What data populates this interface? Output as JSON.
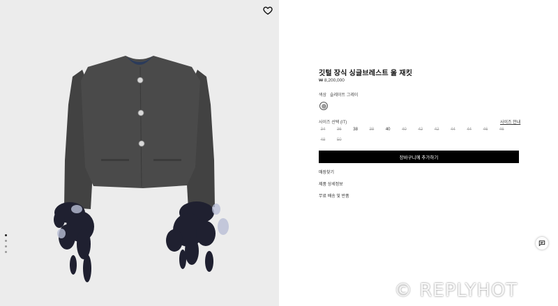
{
  "product": {
    "title": "깃털 장식 싱글브레스트 울 재킷",
    "price": "₩ 8,200,000"
  },
  "color": {
    "label": "색상",
    "value": "슬레이트 그레이"
  },
  "size": {
    "label": "사이즈 선택 (IT)",
    "guide": "사이즈 안내",
    "options": [
      {
        "label": "34",
        "available": false
      },
      {
        "label": "36",
        "available": false
      },
      {
        "label": "38",
        "available": true
      },
      {
        "label": "38",
        "available": false
      },
      {
        "label": "40",
        "available": true
      },
      {
        "label": "40",
        "available": false
      },
      {
        "label": "42",
        "available": false
      },
      {
        "label": "42",
        "available": false
      },
      {
        "label": "44",
        "available": false
      },
      {
        "label": "44",
        "available": false
      },
      {
        "label": "46",
        "available": false
      },
      {
        "label": "46",
        "available": false
      },
      {
        "label": "48",
        "available": false
      },
      {
        "label": "50",
        "available": false
      }
    ]
  },
  "actions": {
    "add_to_cart": "장바구니에 추가하기",
    "find_store": "매장찾기",
    "details": "제품 상세정보",
    "shipping": "무료 배송 및 반품"
  },
  "gallery": {
    "image_count": 4,
    "active_index": 0
  },
  "watermark": "© REPLYHOT",
  "icons": {
    "favorite": "heart-icon",
    "chat": "chat-icon"
  }
}
